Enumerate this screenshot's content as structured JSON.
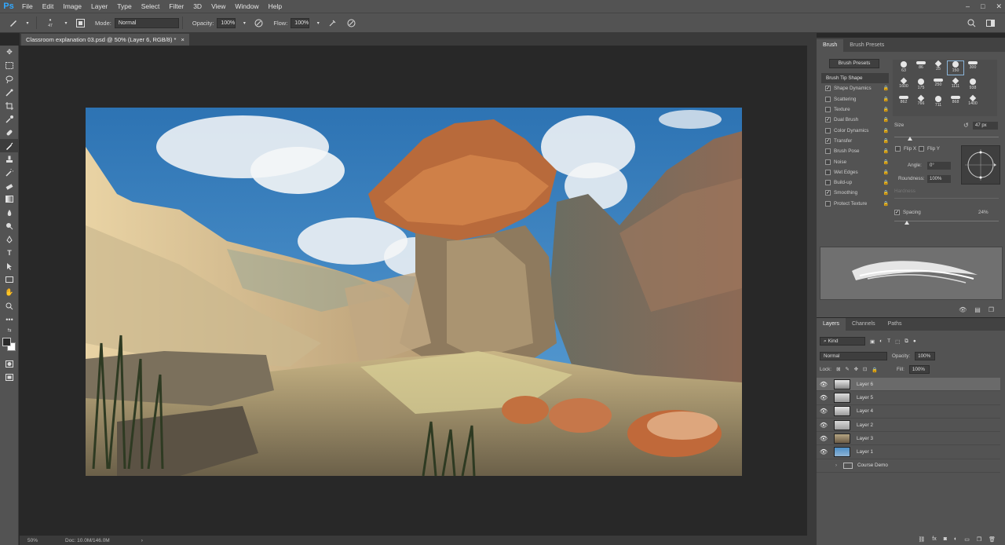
{
  "app": {
    "logo": "Ps",
    "menu": [
      "File",
      "Edit",
      "Image",
      "Layer",
      "Type",
      "Select",
      "Filter",
      "3D",
      "View",
      "Window",
      "Help"
    ]
  },
  "options_bar": {
    "brush_size": "47",
    "mode_label": "Mode:",
    "mode_value": "Normal",
    "opacity_label": "Opacity:",
    "opacity_value": "100%",
    "flow_label": "Flow:",
    "flow_value": "100%"
  },
  "document": {
    "tab_title": "Classroom explanation 03.psd @ 50% (Layer 6, RGB/8) *",
    "tab_close": "×",
    "zoom": "50%",
    "doc_info": "Doc: 10.0M/146.0M"
  },
  "brush_panel": {
    "tabs": [
      "Brush",
      "Brush Presets"
    ],
    "presets_button": "Brush Presets",
    "options": [
      {
        "label": "Brush Tip Shape",
        "checked": null,
        "header": true
      },
      {
        "label": "Shape Dynamics",
        "checked": true
      },
      {
        "label": "Scattering",
        "checked": false
      },
      {
        "label": "Texture",
        "checked": false
      },
      {
        "label": "Dual Brush",
        "checked": true
      },
      {
        "label": "Color Dynamics",
        "checked": false
      },
      {
        "label": "Transfer",
        "checked": true
      },
      {
        "label": "Brush Pose",
        "checked": false
      },
      {
        "label": "Noise",
        "checked": false
      },
      {
        "label": "Wet Edges",
        "checked": false
      },
      {
        "label": "Build-up",
        "checked": false
      },
      {
        "label": "Smoothing",
        "checked": true
      },
      {
        "label": "Protect Texture",
        "checked": false
      }
    ],
    "tip_sizes": [
      "63",
      "86",
      "25",
      "150",
      "300",
      "1600",
      "175",
      "250",
      "1111",
      "938",
      "862",
      "766",
      "711",
      "868",
      "1400"
    ],
    "size_label": "Size",
    "size_value": "47 px",
    "size_fraction": 0.15,
    "flip_x": "Flip X",
    "flip_y": "Flip Y",
    "angle_label": "Angle:",
    "angle_value": "0°",
    "roundness_label": "Roundness:",
    "roundness_value": "100%",
    "hardness_label": "Hardness",
    "spacing_label": "Spacing",
    "spacing_value": "24%",
    "spacing_fraction": 0.12
  },
  "layers_panel": {
    "tabs": [
      "Layers",
      "Channels",
      "Paths"
    ],
    "kind": "Kind",
    "blend_mode": "Normal",
    "opacity_label": "Opacity:",
    "opacity_value": "100%",
    "lock_label": "Lock:",
    "fill_label": "Fill:",
    "fill_value": "100%",
    "layers": [
      {
        "name": "Layer 6",
        "visible": true,
        "selected": true
      },
      {
        "name": "Layer 5",
        "visible": true,
        "selected": false
      },
      {
        "name": "Layer 4",
        "visible": true,
        "selected": false
      },
      {
        "name": "Layer 2",
        "visible": true,
        "selected": false
      },
      {
        "name": "Layer 3",
        "visible": true,
        "selected": false
      },
      {
        "name": "Layer 1",
        "visible": true,
        "selected": false
      }
    ],
    "group_name": "Course Demo",
    "bottom_icons": [
      "fx"
    ]
  }
}
